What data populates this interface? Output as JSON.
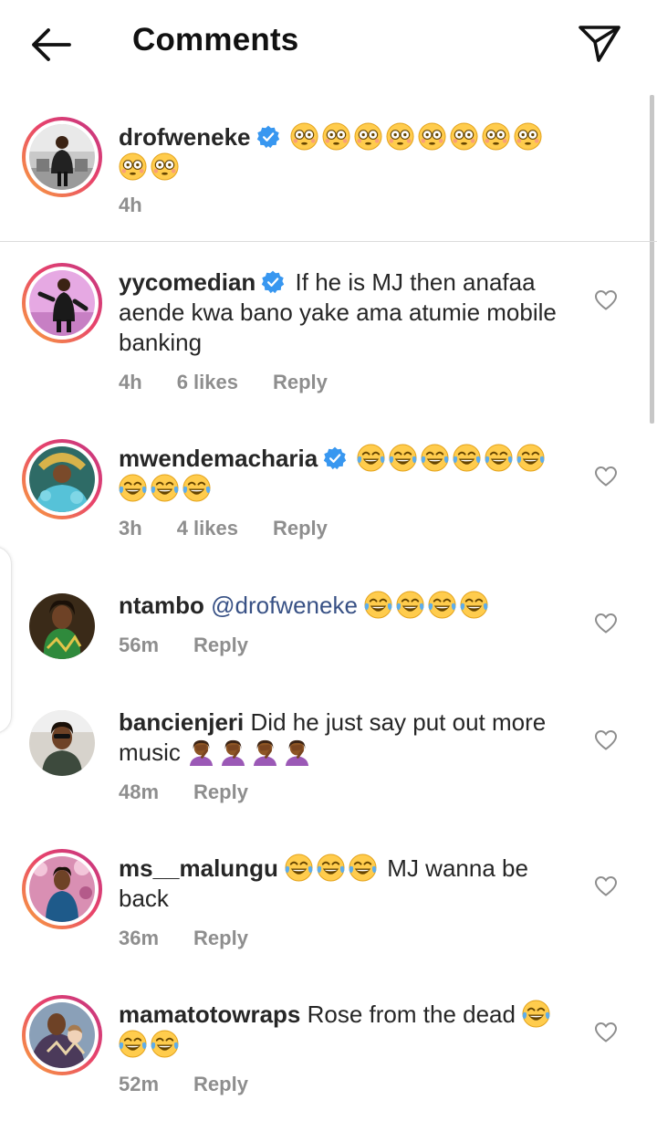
{
  "header": {
    "title": "Comments"
  },
  "icons": {
    "back": "arrow-left-icon",
    "send": "paper-plane-icon",
    "verified": "verified-badge-icon",
    "like": "heart-outline-icon",
    "flushed": "flushed-face-emoji",
    "laughing": "tears-of-joy-emoji",
    "facepalm": "woman-facepalming-emoji"
  },
  "colors": {
    "verified": "#3897f0",
    "mention": "#385185",
    "meta": "#8e8e8e",
    "ring_start": "#f9a53c",
    "ring_end": "#c13584"
  },
  "caption": {
    "username": "drofweneke",
    "verified": true,
    "text": "😳😳😳😳😳😳😳😳😳😳",
    "time": "4h"
  },
  "comments": [
    {
      "username": "yycomedian",
      "verified": true,
      "text": "If he is MJ then anafaa aende kwa bano yake ama atumie mobile banking",
      "time": "4h",
      "likes": "6 likes",
      "reply": "Reply"
    },
    {
      "username": "mwendemacharia",
      "verified": true,
      "text": "😂😂😂😂😂😂😂😂😂",
      "time": "3h",
      "likes": "4 likes",
      "reply": "Reply"
    },
    {
      "username": "ntambo",
      "mention": "@drofweneke",
      "text": "😂😂😂😂",
      "time": "56m",
      "reply": "Reply"
    },
    {
      "username": "bancienjeri",
      "text": "Did he just say put out more music",
      "emoji_text": "🤦🏾‍♀️🤦🏾‍♀️🤦🏾‍♀️🤦🏾‍♀️",
      "time": "48m",
      "reply": "Reply"
    },
    {
      "username": "ms__malungu",
      "text": "MJ wanna be back",
      "emoji_text": "😂😂😂",
      "time": "36m",
      "reply": "Reply"
    },
    {
      "username": "mamatotowraps",
      "text": "Rose from the dead",
      "emoji_text": "😂😂😂",
      "time": "52m",
      "reply": "Reply"
    }
  ]
}
